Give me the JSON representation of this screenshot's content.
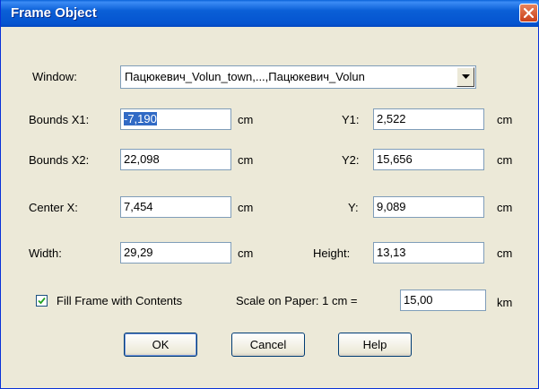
{
  "window": {
    "title": "Frame Object"
  },
  "fields": {
    "window_label": "Window:",
    "window_value": "Пацюкевич_Volun_town,...,Пацюкевич_Volun",
    "bounds_x1_label": "Bounds X1:",
    "bounds_x1_value": "-7,190",
    "bounds_x2_label": "Bounds X2:",
    "bounds_x2_value": "22,098",
    "y1_label": "Y1:",
    "y1_value": "2,522",
    "y2_label": "Y2:",
    "y2_value": "15,656",
    "center_x_label": "Center X:",
    "center_x_value": "7,454",
    "center_y_label": "Y:",
    "center_y_value": "9,089",
    "width_label": "Width:",
    "width_value": "29,29",
    "height_label": "Height:",
    "height_value": "13,13",
    "unit_cm": "cm",
    "unit_km": "km",
    "fill_frame_label": "Fill Frame with Contents",
    "fill_frame_checked": true,
    "scale_label": "Scale on Paper: 1 cm =",
    "scale_value": "15,00"
  },
  "buttons": {
    "ok": "OK",
    "cancel": "Cancel",
    "help": "Help"
  },
  "icons": {
    "close": "close-icon",
    "dropdown": "chevron-down-icon",
    "check": "checkmark-icon"
  },
  "colors": {
    "titlebar": "#0554d0",
    "dialog_bg": "#ece9d8",
    "close_button": "#c9401a",
    "selection": "#316ac5"
  }
}
